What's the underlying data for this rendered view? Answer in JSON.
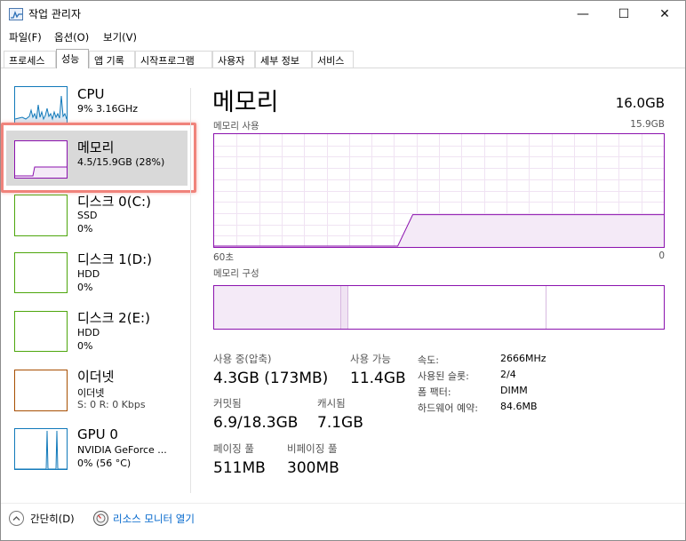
{
  "window": {
    "title": "작업 관리자",
    "controls": {
      "minimize": "—",
      "maximize": "☐",
      "close": "✕"
    }
  },
  "menu": [
    "파일(F)",
    "옵션(O)",
    "보기(V)"
  ],
  "tabs": [
    "프로세스",
    "성능",
    "앱 기록",
    "시작프로그램",
    "사용자",
    "세부 정보",
    "서비스"
  ],
  "active_tab": "성능",
  "sidebar": {
    "items": [
      {
        "name": "CPU",
        "line1": "9% 3.16GHz",
        "line2": "",
        "color": "#1179ba"
      },
      {
        "name": "메모리",
        "line1": "4.5/15.9GB (28%)",
        "line2": "",
        "color": "#8b12ae",
        "selected": true
      },
      {
        "name": "디스크 0(C:)",
        "line1": "SSD",
        "line2": "0%",
        "color": "#4da60c"
      },
      {
        "name": "디스크 1(D:)",
        "line1": "HDD",
        "line2": "0%",
        "color": "#4da60c"
      },
      {
        "name": "디스크 2(E:)",
        "line1": "HDD",
        "line2": "0%",
        "color": "#4da60c"
      },
      {
        "name": "이더넷",
        "line1": "이더넷",
        "line2": "S: 0 R: 0 Kbps",
        "color": "#a74f01"
      },
      {
        "name": "GPU 0",
        "line1": "NVIDIA GeForce ...",
        "line2": "0% (56 °C)",
        "color": "#1179ba"
      }
    ]
  },
  "main": {
    "title": "메모리",
    "total": "16.0GB",
    "usage_label": "메모리 사용",
    "usage_max": "15.9GB",
    "axis_left": "60초",
    "axis_right": "0",
    "composition_label": "메모리 구성",
    "usage_graph": {
      "x_seconds_ago": [
        60,
        35.5,
        33.5,
        0
      ],
      "y_gb": [
        0,
        0,
        4.5,
        4.5
      ],
      "y_max_gb": 15.9
    },
    "composition": {
      "in_use_fraction": 0.28,
      "modified_fraction": 0.018,
      "standby_fraction": 0.44,
      "free_fraction": 0.26
    },
    "stats": [
      {
        "label": "사용 중(압축)",
        "value": "4.3GB (173MB)"
      },
      {
        "label": "사용 가능",
        "value": "11.4GB"
      },
      {
        "label": "커밋됨",
        "value": "6.9/18.3GB"
      },
      {
        "label": "캐시됨",
        "value": "7.1GB"
      },
      {
        "label": "페이징 풀",
        "value": "511MB"
      },
      {
        "label": "비페이징 풀",
        "value": "300MB"
      }
    ],
    "details": [
      {
        "label": "속도:",
        "value": "2666MHz"
      },
      {
        "label": "사용된 슬롯:",
        "value": "2/4"
      },
      {
        "label": "폼 팩터:",
        "value": "DIMM"
      },
      {
        "label": "하드웨어 예약:",
        "value": "84.6MB"
      }
    ]
  },
  "footer": {
    "collapse": "간단히(D)",
    "resource_monitor": "리소스 모니터 열기"
  }
}
